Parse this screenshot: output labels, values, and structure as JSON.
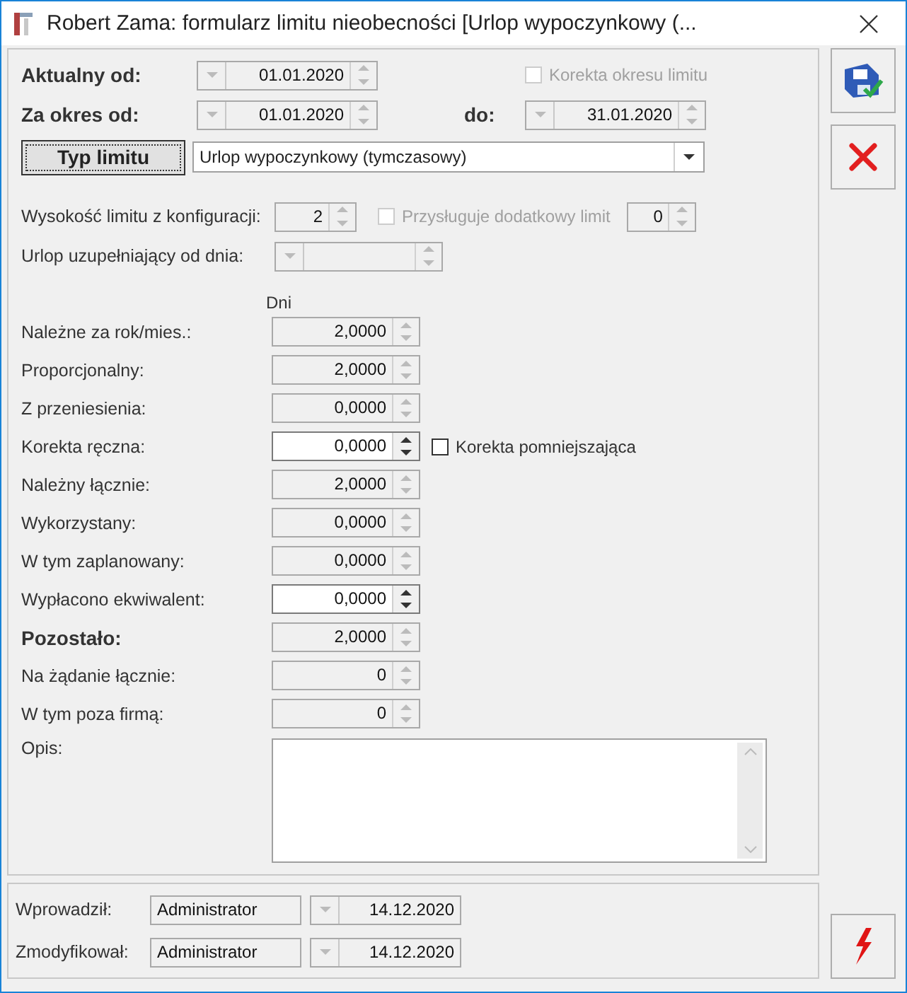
{
  "window": {
    "title": "Robert Zama: formularz limitu nieobecności [Urlop wypoczynkowy (..."
  },
  "aktualny_od": {
    "label": "Aktualny od:",
    "value": "01.01.2020"
  },
  "korekta_okresu": {
    "label": "Korekta okresu limitu",
    "checked": false,
    "disabled": true
  },
  "za_okres_od": {
    "label": "Za okres od:",
    "value": "01.01.2020"
  },
  "do": {
    "label": "do:",
    "value": "31.01.2020"
  },
  "typ_limitu": {
    "button": "Typ limitu",
    "value": "Urlop wypoczynkowy (tymczasowy)"
  },
  "konfiguracja": {
    "label": "Wysokość limitu z konfiguracji:",
    "value": "2"
  },
  "dodatkowy": {
    "label": "Przysługuje dodatkowy limit",
    "checked": false,
    "disabled": true,
    "value": "0"
  },
  "uzupelniajacy": {
    "label": "Urlop uzupełniający od dnia:"
  },
  "days_header": "Dni",
  "rows": [
    {
      "label": "Należne za rok/mies.:",
      "value": "2,0000",
      "editable": false,
      "bold": false
    },
    {
      "label": "Proporcjonalny:",
      "value": "2,0000",
      "editable": false,
      "bold": false
    },
    {
      "label": "Z przeniesienia:",
      "value": "0,0000",
      "editable": false,
      "bold": false
    },
    {
      "label": "Korekta ręczna:",
      "value": "0,0000",
      "editable": true,
      "bold": false,
      "checkbox": {
        "label": "Korekta pomniejszająca",
        "checked": false,
        "disabled": false
      }
    },
    {
      "label": "Należny łącznie:",
      "value": "2,0000",
      "editable": false,
      "bold": false
    },
    {
      "label": "Wykorzystany:",
      "value": "0,0000",
      "editable": false,
      "bold": false
    },
    {
      "label": "W tym zaplanowany:",
      "value": "0,0000",
      "editable": false,
      "bold": false
    },
    {
      "label": "Wypłacono ekwiwalent:",
      "value": "0,0000",
      "editable": true,
      "bold": false
    },
    {
      "label": "Pozostało:",
      "value": "2,0000",
      "editable": false,
      "bold": true
    },
    {
      "label": "Na żądanie łącznie:",
      "value": "0",
      "editable": false,
      "bold": false
    },
    {
      "label": "W tym poza firmą:",
      "value": "0",
      "editable": false,
      "bold": false
    }
  ],
  "opis": {
    "label": "Opis:"
  },
  "footer": [
    {
      "label": "Wprowadził:",
      "user": "Administrator",
      "date": "14.12.2020"
    },
    {
      "label": "Zmodyfikował:",
      "user": "Administrator",
      "date": "14.12.2020"
    }
  ]
}
